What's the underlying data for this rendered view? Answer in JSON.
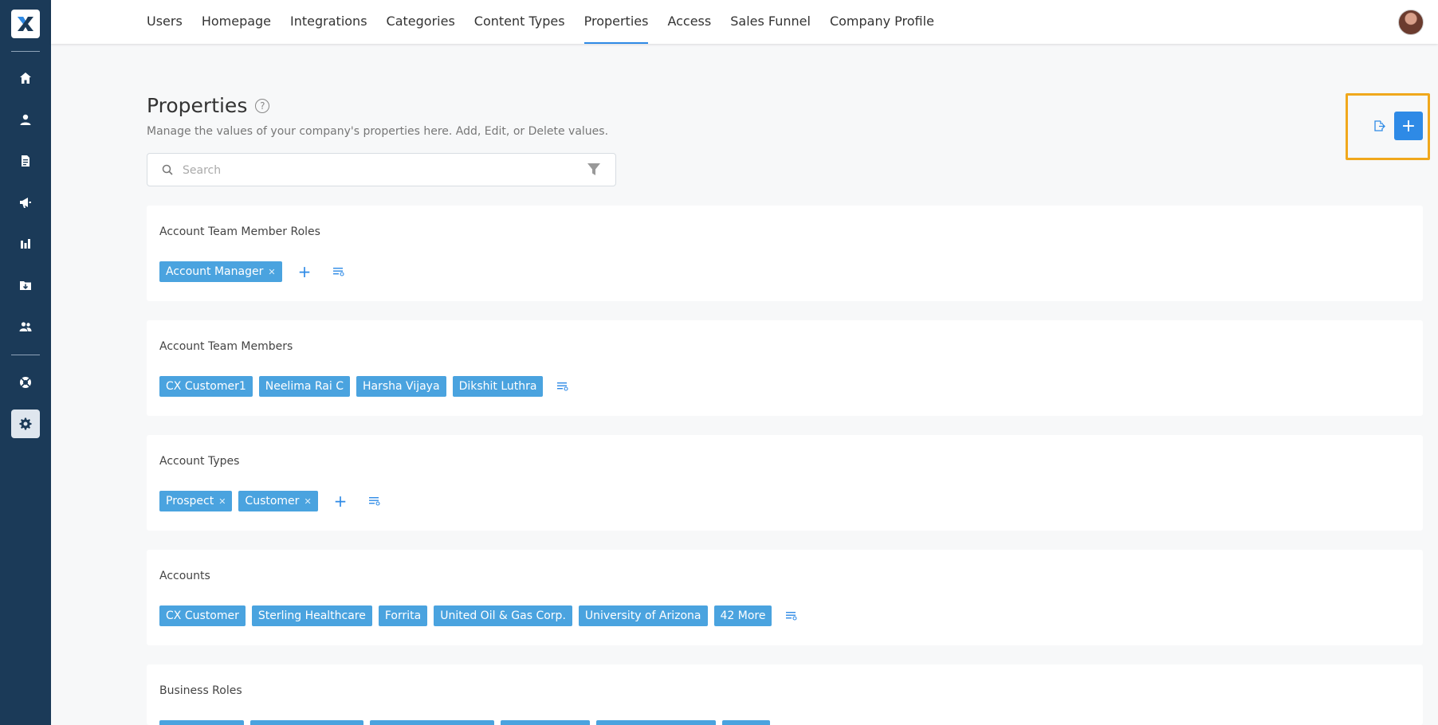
{
  "nav": {
    "tabs": [
      {
        "label": "Users"
      },
      {
        "label": "Homepage"
      },
      {
        "label": "Integrations"
      },
      {
        "label": "Categories"
      },
      {
        "label": "Content Types"
      },
      {
        "label": "Properties",
        "active": true
      },
      {
        "label": "Access"
      },
      {
        "label": "Sales Funnel"
      },
      {
        "label": "Company Profile"
      }
    ]
  },
  "sidebar": {
    "items": [
      "home-icon",
      "user-icon",
      "document-icon",
      "megaphone-icon",
      "bar-chart-icon",
      "folder-icon",
      "team-icon",
      "support-icon",
      "gear-icon"
    ],
    "active_item": "gear-icon"
  },
  "header": {
    "title": "Properties",
    "help_glyph": "?",
    "subtitle": "Manage the values of your company's properties here. Add, Edit, or Delete values."
  },
  "search": {
    "placeholder": "Search",
    "value": ""
  },
  "actions": {
    "add_glyph": "+"
  },
  "properties": [
    {
      "title": "Account Team Member Roles",
      "values": [
        {
          "label": "Account Manager",
          "removable": true
        }
      ],
      "show_add": true
    },
    {
      "title": "Account Team Members",
      "values": [
        {
          "label": "CX Customer1"
        },
        {
          "label": "Neelima Rai C"
        },
        {
          "label": "Harsha Vijaya"
        },
        {
          "label": "Dikshit Luthra"
        }
      ],
      "show_add": false
    },
    {
      "title": "Account Types",
      "values": [
        {
          "label": "Prospect",
          "removable": true
        },
        {
          "label": "Customer",
          "removable": true
        }
      ],
      "show_add": true
    },
    {
      "title": "Accounts",
      "values": [
        {
          "label": "CX Customer"
        },
        {
          "label": "Sterling Healthcare"
        },
        {
          "label": "Forrita"
        },
        {
          "label": "United Oil & Gas Corp."
        },
        {
          "label": "University of Arizona"
        },
        {
          "label": "42 More"
        }
      ],
      "show_add": false
    },
    {
      "title": "Business Roles",
      "values": [],
      "show_add": false
    }
  ],
  "colors": {
    "sidebar": "#1b3a58",
    "accent": "#2e8ae6",
    "chip": "#4aa3df",
    "highlight": "#f0a81c"
  }
}
